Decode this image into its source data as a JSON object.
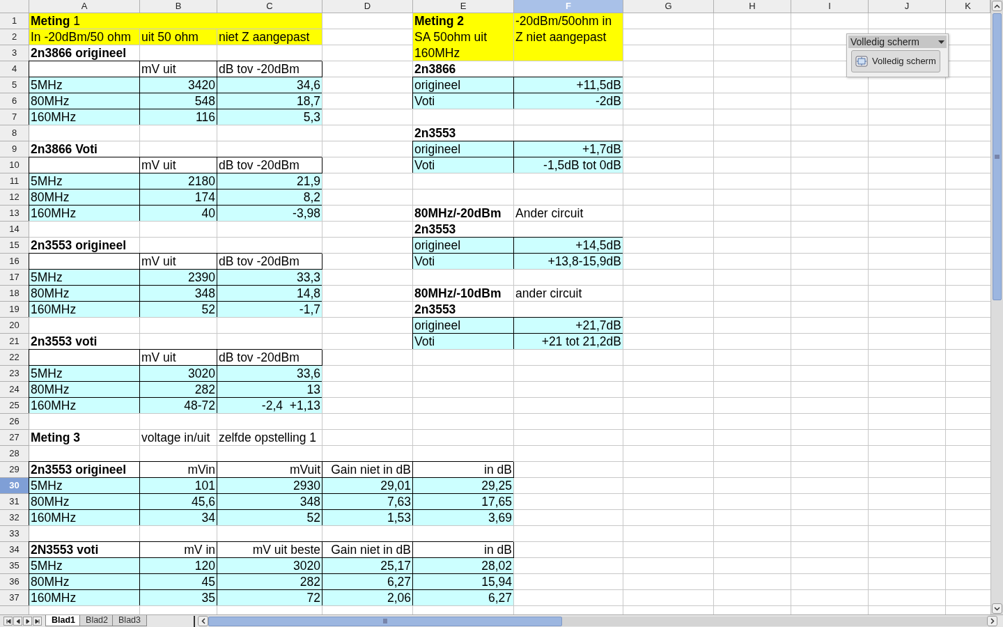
{
  "columns": [
    {
      "label": "A",
      "selected": false
    },
    {
      "label": "B",
      "selected": false
    },
    {
      "label": "C",
      "selected": false
    },
    {
      "label": "D",
      "selected": false
    },
    {
      "label": "E",
      "selected": false
    },
    {
      "label": "F",
      "selected": true
    },
    {
      "label": "G",
      "selected": false
    },
    {
      "label": "H",
      "selected": false
    },
    {
      "label": "I",
      "selected": false
    },
    {
      "label": "J",
      "selected": false
    },
    {
      "label": "K",
      "selected": false
    }
  ],
  "rows": [
    {
      "number": "1",
      "selected": false,
      "A": {
        "text": "**Meting** 1",
        "color": "#ffff00"
      },
      "B": {
        "merged_left": true
      },
      "C": {
        "merged_left": true
      },
      "E": {
        "lines": [
          "**Meting 2**",
          "SA 50ohm uit",
          "160MHz"
        ],
        "color": "#ffff00"
      },
      "F": {
        "lines": [
          "-20dBm/50ohm in",
          "Z niet aangepast"
        ],
        "color": "#ffff00"
      }
    },
    {
      "number": "2",
      "selected": false,
      "A": {
        "text": "In -20dBm/50 ohm",
        "color": "#ffff00"
      },
      "B": {
        "text": "uit 50 ohm",
        "color": "#ffff00"
      },
      "C": {
        "text": "niet Z aangepast",
        "color": "#ffff00"
      },
      "E": {
        "merged_up": true
      },
      "F": {
        "merged_up": true
      }
    },
    {
      "number": "3",
      "selected": false,
      "A": {
        "text": "2n3866 origineel",
        "bold": true
      },
      "E": {
        "merged_up": true
      },
      "F": {
        "merged_up": true
      }
    },
    {
      "number": "4",
      "selected": false,
      "A": {
        "border": true
      },
      "B": {
        "text": "mV uit",
        "border": true
      },
      "C": {
        "text": "dB tov -20dBm",
        "border": true
      },
      "E": {
        "text": "2n3866",
        "bold": true
      }
    },
    {
      "number": "5",
      "selected": false,
      "A": {
        "text": "5MHz",
        "color": "#ccffff",
        "border": true
      },
      "B": {
        "text": "3420",
        "color": "#ccffff",
        "border": true,
        "numeric": true
      },
      "C": {
        "text": "34,6",
        "color": "#ccffff",
        "border": true,
        "numeric": true
      },
      "E": {
        "text": "origineel",
        "color": "#ccffff",
        "border": true
      },
      "F": {
        "text": "+11,5dB",
        "color": "#ccffff",
        "border": true,
        "numeric": true
      }
    },
    {
      "number": "6",
      "selected": false,
      "A": {
        "text": "80MHz",
        "color": "#ccffff",
        "border": true
      },
      "B": {
        "text": "548",
        "color": "#ccffff",
        "border": true,
        "numeric": true
      },
      "C": {
        "text": "18,7",
        "color": "#ccffff",
        "border": true,
        "numeric": true
      },
      "E": {
        "text": "Voti",
        "color": "#ccffff",
        "border": true
      },
      "F": {
        "text": "-2dB",
        "color": "#ccffff",
        "border": true,
        "numeric": true
      }
    },
    {
      "number": "7",
      "selected": false,
      "A": {
        "text": "160MHz",
        "color": "#ccffff",
        "border": true
      },
      "B": {
        "text": "116",
        "color": "#ccffff",
        "border": true,
        "numeric": true
      },
      "C": {
        "text": "5,3",
        "color": "#ccffff",
        "border": true,
        "numeric": true
      }
    },
    {
      "number": "8",
      "selected": false,
      "E": {
        "text": "2n3553",
        "bold": true
      }
    },
    {
      "number": "9",
      "selected": false,
      "A": {
        "text": "2n3866 Voti",
        "bold": true
      },
      "E": {
        "text": "origineel",
        "color": "#ccffff",
        "border": true
      },
      "F": {
        "text": "+1,7dB",
        "color": "#ccffff",
        "border": true,
        "numeric": true
      }
    },
    {
      "number": "10",
      "selected": false,
      "A": {
        "border": true
      },
      "B": {
        "text": "mV uit",
        "border": true
      },
      "C": {
        "text": "dB tov -20dBm",
        "border": true
      },
      "E": {
        "text": "Voti",
        "color": "#ccffff",
        "border": true
      },
      "F": {
        "text": "-1,5dB tot 0dB",
        "color": "#ccffff",
        "border": true,
        "numeric": true
      }
    },
    {
      "number": "11",
      "selected": false,
      "A": {
        "text": "5MHz",
        "color": "#ccffff",
        "border": true
      },
      "B": {
        "text": "2180",
        "color": "#ccffff",
        "border": true,
        "numeric": true
      },
      "C": {
        "text": "21,9",
        "color": "#ccffff",
        "border": true,
        "numeric": true
      }
    },
    {
      "number": "12",
      "selected": false,
      "A": {
        "text": "80MHz",
        "color": "#ccffff",
        "border": true
      },
      "B": {
        "text": "174",
        "color": "#ccffff",
        "border": true,
        "numeric": true
      },
      "C": {
        "text": "8,2",
        "color": "#ccffff",
        "border": true,
        "numeric": true
      }
    },
    {
      "number": "13",
      "selected": false,
      "A": {
        "text": "160MHz",
        "color": "#ccffff",
        "border": true
      },
      "B": {
        "text": "40",
        "color": "#ccffff",
        "border": true,
        "numeric": true
      },
      "C": {
        "text": "-3,98",
        "color": "#ccffff",
        "border": true,
        "numeric": true
      },
      "E": {
        "text": "80MHz/-20dBm",
        "bold": true
      },
      "F": {
        "text": "Ander circuit"
      }
    },
    {
      "number": "14",
      "selected": false,
      "E": {
        "text": "2n3553",
        "bold": true
      }
    },
    {
      "number": "15",
      "selected": false,
      "A": {
        "text": "2n3553 origineel",
        "bold": true
      },
      "E": {
        "text": "origineel",
        "color": "#ccffff",
        "border": true
      },
      "F": {
        "text": "+14,5dB",
        "color": "#ccffff",
        "border": true,
        "numeric": true
      }
    },
    {
      "number": "16",
      "selected": false,
      "A": {
        "border": true
      },
      "B": {
        "text": "mV uit",
        "border": true
      },
      "C": {
        "text": "dB tov -20dBm",
        "border": true
      },
      "E": {
        "text": "Voti",
        "color": "#ccffff",
        "border": true
      },
      "F": {
        "text": "+13,8-15,9dB",
        "color": "#ccffff",
        "border": true,
        "numeric": true
      }
    },
    {
      "number": "17",
      "selected": false,
      "A": {
        "text": "5MHz",
        "color": "#ccffff",
        "border": true
      },
      "B": {
        "text": "2390",
        "color": "#ccffff",
        "border": true,
        "numeric": true
      },
      "C": {
        "text": "33,3",
        "color": "#ccffff",
        "border": true,
        "numeric": true
      }
    },
    {
      "number": "18",
      "selected": false,
      "A": {
        "text": "80MHz",
        "color": "#ccffff",
        "border": true
      },
      "B": {
        "text": "348",
        "color": "#ccffff",
        "border": true,
        "numeric": true
      },
      "C": {
        "text": "14,8",
        "color": "#ccffff",
        "border": true,
        "numeric": true
      },
      "E": {
        "text": "80MHz/-10dBm",
        "bold": true
      },
      "F": {
        "text": "ander circuit"
      }
    },
    {
      "number": "19",
      "selected": false,
      "A": {
        "text": "160MHz",
        "color": "#ccffff",
        "border": true
      },
      "B": {
        "text": "52",
        "color": "#ccffff",
        "border": true,
        "numeric": true
      },
      "C": {
        "text": "-1,7",
        "color": "#ccffff",
        "border": true,
        "numeric": true
      },
      "E": {
        "text": "2n3553",
        "bold": true
      }
    },
    {
      "number": "20",
      "selected": false,
      "E": {
        "text": "origineel",
        "color": "#ccffff",
        "border": true
      },
      "F": {
        "text": "+21,7dB",
        "color": "#ccffff",
        "border": true,
        "numeric": true
      }
    },
    {
      "number": "21",
      "selected": false,
      "A": {
        "text": "2n3553 voti",
        "bold": true
      },
      "E": {
        "text": "Voti",
        "color": "#ccffff",
        "border": true
      },
      "F": {
        "text": "+21 tot 21,2dB",
        "color": "#ccffff",
        "border": true,
        "numeric": true
      }
    },
    {
      "number": "22",
      "selected": false,
      "A": {
        "border": true
      },
      "B": {
        "text": "mV uit",
        "border": true
      },
      "C": {
        "text": "dB tov -20dBm",
        "border": true
      }
    },
    {
      "number": "23",
      "selected": false,
      "A": {
        "text": "5MHz",
        "color": "#ccffff",
        "border": true
      },
      "B": {
        "text": "3020",
        "color": "#ccffff",
        "border": true,
        "numeric": true
      },
      "C": {
        "text": "33,6",
        "color": "#ccffff",
        "border": true,
        "numeric": true
      }
    },
    {
      "number": "24",
      "selected": false,
      "A": {
        "text": "80MHz",
        "color": "#ccffff",
        "border": true
      },
      "B": {
        "text": "282",
        "color": "#ccffff",
        "border": true,
        "numeric": true
      },
      "C": {
        "text": "13",
        "color": "#ccffff",
        "border": true,
        "numeric": true
      }
    },
    {
      "number": "25",
      "selected": false,
      "A": {
        "text": "160MHz",
        "color": "#ccffff",
        "border": true
      },
      "B": {
        "text": "48-72",
        "color": "#ccffff",
        "border": true,
        "numeric": true
      },
      "C": {
        "text": "-2,4  +1,13",
        "color": "#ccffff",
        "border": true,
        "numeric": true
      }
    },
    {
      "number": "26",
      "selected": false
    },
    {
      "number": "27",
      "selected": false,
      "A": {
        "text": "Meting 3",
        "bold": true
      },
      "B": {
        "text": "voltage in/uit"
      },
      "C": {
        "text": "zelfde opstelling 1"
      }
    },
    {
      "number": "28",
      "selected": false
    },
    {
      "number": "29",
      "selected": false,
      "A": {
        "text": "2n3553 origineel",
        "bold": true,
        "border": true
      },
      "B": {
        "text": "mVin",
        "border": true,
        "numeric": true
      },
      "C": {
        "text": "mVuit",
        "border": true,
        "numeric": true
      },
      "D": {
        "text": "Gain niet in dB",
        "border": true,
        "numeric": true
      },
      "E": {
        "text": "in dB",
        "border": true,
        "numeric": true
      }
    },
    {
      "number": "30",
      "selected": true,
      "A": {
        "text": "5MHz",
        "color": "#ccffff",
        "border": true
      },
      "B": {
        "text": "101",
        "color": "#ccffff",
        "border": true,
        "numeric": true
      },
      "C": {
        "text": "2930",
        "color": "#ccffff",
        "border": true,
        "numeric": true
      },
      "D": {
        "text": "29,01",
        "color": "#ccffff",
        "border": true,
        "numeric": true
      },
      "E": {
        "text": "29,25",
        "color": "#ccffff",
        "border": true,
        "numeric": true
      }
    },
    {
      "number": "31",
      "selected": false,
      "A": {
        "text": "80MHz",
        "color": "#ccffff",
        "border": true
      },
      "B": {
        "text": "45,6",
        "color": "#ccffff",
        "border": true,
        "numeric": true
      },
      "C": {
        "text": "348",
        "color": "#ccffff",
        "border": true,
        "numeric": true
      },
      "D": {
        "text": "7,63",
        "color": "#ccffff",
        "border": true,
        "numeric": true
      },
      "E": {
        "text": "17,65",
        "color": "#ccffff",
        "border": true,
        "numeric": true
      }
    },
    {
      "number": "32",
      "selected": false,
      "A": {
        "text": "160MHz",
        "color": "#ccffff",
        "border": true
      },
      "B": {
        "text": "34",
        "color": "#ccffff",
        "border": true,
        "numeric": true
      },
      "C": {
        "text": "52",
        "color": "#ccffff",
        "border": true,
        "numeric": true
      },
      "D": {
        "text": "1,53",
        "color": "#ccffff",
        "border": true,
        "numeric": true
      },
      "E": {
        "text": "3,69",
        "color": "#ccffff",
        "border": true,
        "numeric": true
      }
    },
    {
      "number": "33",
      "selected": false
    },
    {
      "number": "34",
      "selected": false,
      "A": {
        "text": "2N3553 voti",
        "bold": true,
        "border": true
      },
      "B": {
        "text": "mV in",
        "border": true,
        "numeric": true
      },
      "C": {
        "text": "mV uit beste",
        "border": true,
        "numeric": true
      },
      "D": {
        "text": "Gain niet in dB",
        "border": true,
        "numeric": true
      },
      "E": {
        "text": "in dB",
        "border": true,
        "numeric": true
      }
    },
    {
      "number": "35",
      "selected": false,
      "A": {
        "text": "5MHz",
        "color": "#ccffff",
        "border": true
      },
      "B": {
        "text": "120",
        "color": "#ccffff",
        "border": true,
        "numeric": true
      },
      "C": {
        "text": "3020",
        "color": "#ccffff",
        "border": true,
        "numeric": true
      },
      "D": {
        "text": "25,17",
        "color": "#ccffff",
        "border": true,
        "numeric": true
      },
      "E": {
        "text": "28,02",
        "color": "#ccffff",
        "border": true,
        "numeric": true
      }
    },
    {
      "number": "36",
      "selected": false,
      "A": {
        "text": "80MHz",
        "color": "#ccffff",
        "border": true
      },
      "B": {
        "text": "45",
        "color": "#ccffff",
        "border": true,
        "numeric": true
      },
      "C": {
        "text": "282",
        "color": "#ccffff",
        "border": true,
        "numeric": true
      },
      "D": {
        "text": "6,27",
        "color": "#ccffff",
        "border": true,
        "numeric": true
      },
      "E": {
        "text": "15,94",
        "color": "#ccffff",
        "border": true,
        "numeric": true
      }
    },
    {
      "number": "37",
      "selected": false,
      "A": {
        "text": "160MHz",
        "color": "#ccffff",
        "border": true
      },
      "B": {
        "text": "35",
        "color": "#ccffff",
        "border": true,
        "numeric": true
      },
      "C": {
        "text": "72",
        "color": "#ccffff",
        "border": true,
        "numeric": true
      },
      "D": {
        "text": "2,06",
        "color": "#ccffff",
        "border": true,
        "numeric": true
      },
      "E": {
        "text": "6,27",
        "color": "#ccffff",
        "border": true,
        "numeric": true
      }
    }
  ],
  "fullscreen_toolbar": {
    "title": "Volledig scherm",
    "button": "Volledig scherm"
  },
  "sheet_tabs": [
    {
      "label": "Blad1",
      "selected": true
    },
    {
      "label": "Blad2",
      "selected": false
    },
    {
      "label": "Blad3",
      "selected": false
    }
  ]
}
